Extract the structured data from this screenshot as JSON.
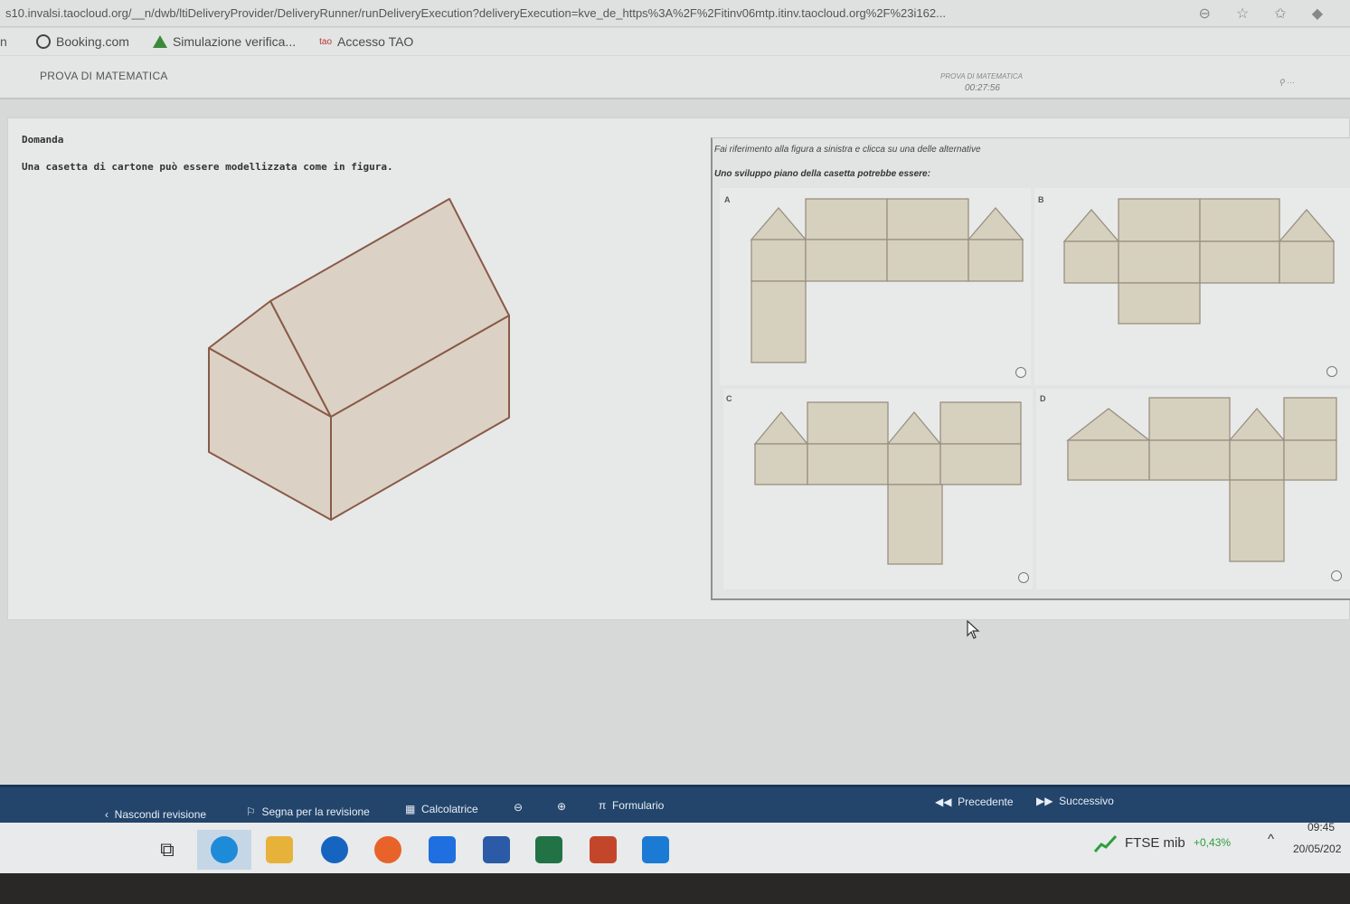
{
  "browser": {
    "url": "s10.invalsi.taocloud.org/__n/dwb/ltiDeliveryProvider/DeliveryRunner/runDeliveryExecution?deliveryExecution=kve_de_https%3A%2F%2Fitinv06mtp.itinv.taocloud.org%2F%23i162..."
  },
  "bookmarks": [
    {
      "label": "Booking.com",
      "icon": "globe-icon"
    },
    {
      "label": "Simulazione verifica...",
      "icon": "drive-icon"
    },
    {
      "label": "Accesso TAO",
      "icon": "tao-icon"
    }
  ],
  "header": {
    "test_title": "PROVA DI MATEMATICA",
    "timer_label": "PROVA DI MATEMATICA",
    "timer": "00:27:56"
  },
  "question": {
    "label": "Domanda",
    "text": "Una casetta di cartone può essere modellizzata come in figura.",
    "instruction_1": "Fai riferimento alla figura a sinistra e clicca su una delle alternative",
    "instruction_2": "Uno sviluppo piano della casetta potrebbe essere:",
    "options": [
      {
        "letter": "A",
        "selected": false
      },
      {
        "letter": "B",
        "selected": false
      },
      {
        "letter": "C",
        "selected": false
      },
      {
        "letter": "D",
        "selected": false
      }
    ]
  },
  "colors": {
    "face_fill": "#dbd2c5",
    "edge": "#8a5a48",
    "net_fill": "#d6d0bf",
    "net_edge": "#9a8f80",
    "toolbar": "#23456b"
  },
  "toolbar": {
    "hide_review": "Nascondi revisione",
    "mark_review": "Segna per la revisione",
    "calculator": "Calcolatrice",
    "formulary": "Formulario",
    "previous": "Precedente",
    "next": "Successivo"
  },
  "taskbar": {
    "ticker_name": "FTSE mib",
    "ticker_change": "+0,43%",
    "time": "09:45",
    "date": "20/05/202"
  }
}
